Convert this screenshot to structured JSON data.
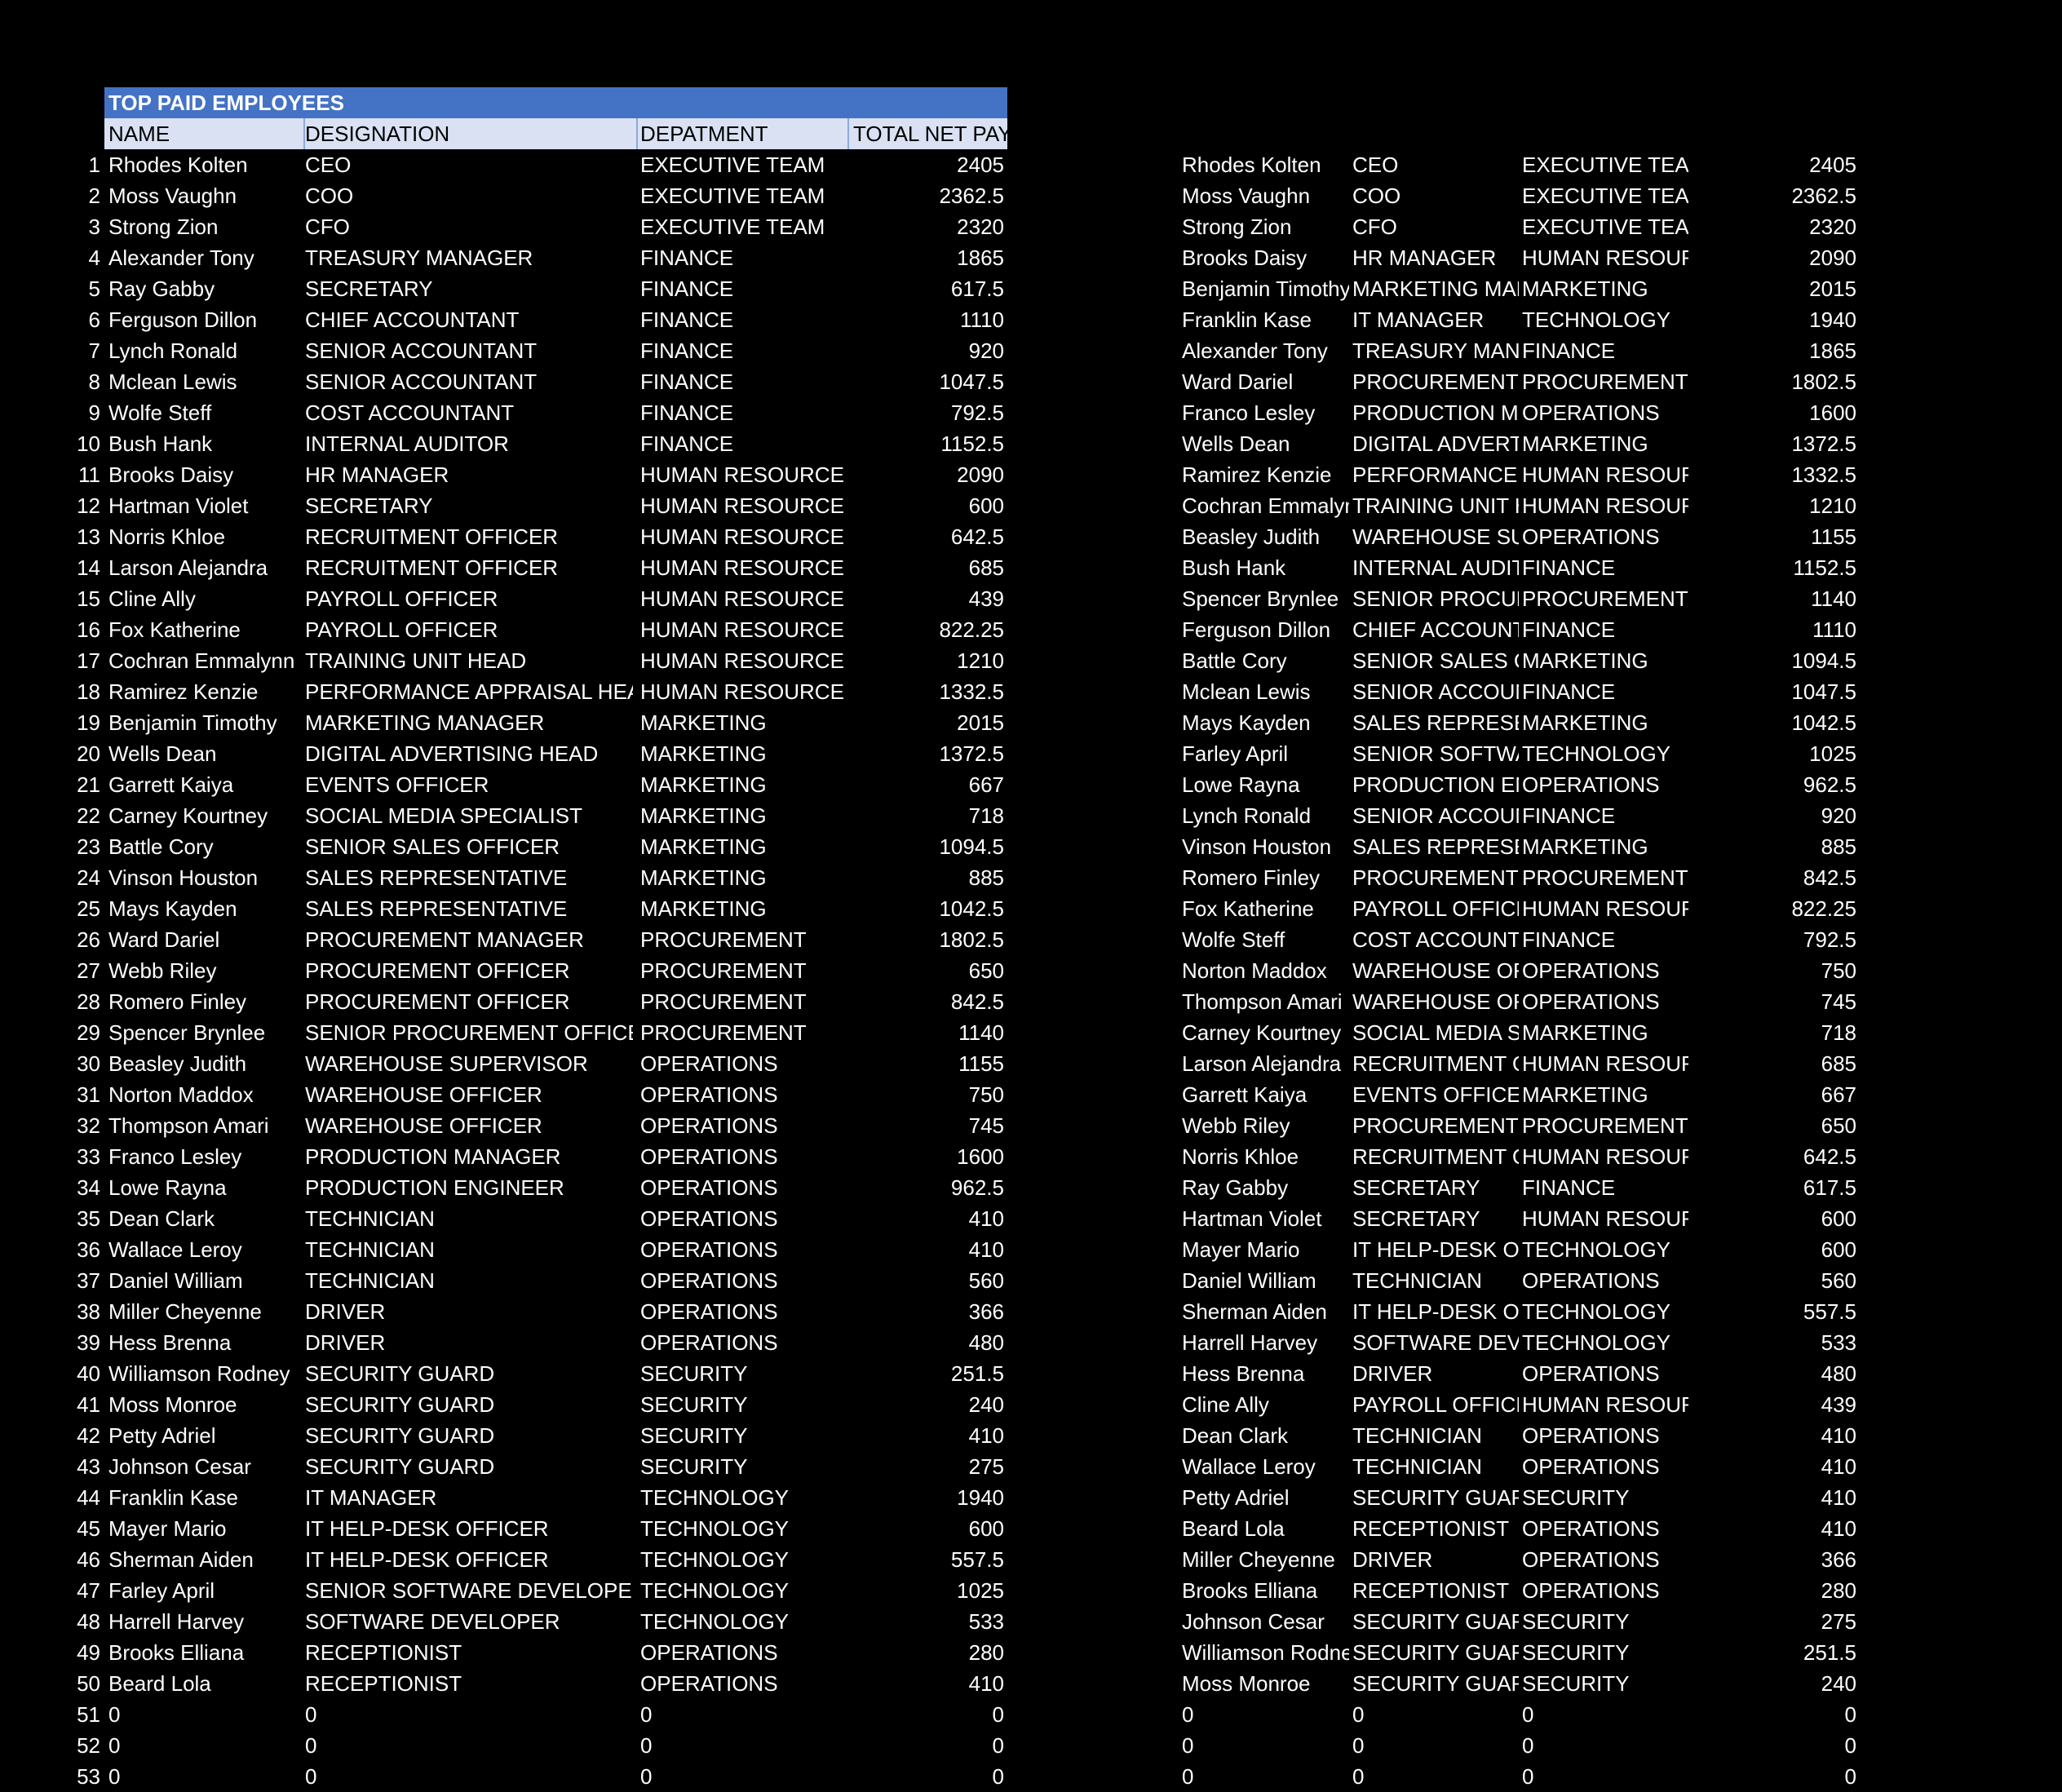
{
  "table": {
    "title": "TOP PAID EMPLOYEES",
    "headers": [
      "NAME",
      "DESIGNATION",
      "DEPATMENT",
      "TOTAL NET PAY"
    ],
    "rows": [
      {
        "n": "1",
        "name": "Rhodes Kolten",
        "designation": "CEO",
        "department": "EXECUTIVE TEAM",
        "pay": "2405"
      },
      {
        "n": "2",
        "name": "Moss Vaughn",
        "designation": "COO",
        "department": "EXECUTIVE TEAM",
        "pay": "2362.5"
      },
      {
        "n": "3",
        "name": "Strong Zion",
        "designation": "CFO",
        "department": "EXECUTIVE TEAM",
        "pay": "2320"
      },
      {
        "n": "4",
        "name": "Alexander Tony",
        "designation": "TREASURY MANAGER",
        "department": "FINANCE",
        "pay": "1865"
      },
      {
        "n": "5",
        "name": "Ray Gabby",
        "designation": "SECRETARY",
        "department": "FINANCE",
        "pay": "617.5"
      },
      {
        "n": "6",
        "name": "Ferguson Dillon",
        "designation": "CHIEF ACCOUNTANT",
        "department": "FINANCE",
        "pay": "1110"
      },
      {
        "n": "7",
        "name": "Lynch Ronald",
        "designation": "SENIOR ACCOUNTANT",
        "department": "FINANCE",
        "pay": "920"
      },
      {
        "n": "8",
        "name": "Mclean Lewis",
        "designation": "SENIOR ACCOUNTANT",
        "department": "FINANCE",
        "pay": "1047.5"
      },
      {
        "n": "9",
        "name": "Wolfe Steff",
        "designation": "COST ACCOUNTANT",
        "department": "FINANCE",
        "pay": "792.5"
      },
      {
        "n": "10",
        "name": "Bush Hank",
        "designation": "INTERNAL AUDITOR",
        "department": "FINANCE",
        "pay": "1152.5"
      },
      {
        "n": "11",
        "name": "Brooks Daisy",
        "designation": "HR MANAGER",
        "department": "HUMAN RESOURCES",
        "pay": "2090"
      },
      {
        "n": "12",
        "name": "Hartman Violet",
        "designation": "SECRETARY",
        "department": "HUMAN RESOURCES",
        "pay": "600"
      },
      {
        "n": "13",
        "name": "Norris Khloe",
        "designation": "RECRUITMENT OFFICER",
        "department": "HUMAN RESOURCES",
        "pay": "642.5"
      },
      {
        "n": "14",
        "name": "Larson Alejandra",
        "designation": "RECRUITMENT OFFICER",
        "department": "HUMAN RESOURCES",
        "pay": "685"
      },
      {
        "n": "15",
        "name": "Cline Ally",
        "designation": "PAYROLL OFFICER",
        "department": "HUMAN RESOURCES",
        "pay": "439"
      },
      {
        "n": "16",
        "name": "Fox Katherine",
        "designation": "PAYROLL OFFICER",
        "department": "HUMAN RESOURCES",
        "pay": "822.25"
      },
      {
        "n": "17",
        "name": "Cochran Emmalynn",
        "designation": "TRAINING UNIT HEAD",
        "department": "HUMAN RESOURCES",
        "pay": "1210"
      },
      {
        "n": "18",
        "name": "Ramirez Kenzie",
        "designation": "PERFORMANCE APPRAISAL HEAD",
        "department": "HUMAN RESOURCES",
        "pay": "1332.5"
      },
      {
        "n": "19",
        "name": "Benjamin Timothy",
        "designation": "MARKETING MANAGER",
        "department": "MARKETING",
        "pay": "2015"
      },
      {
        "n": "20",
        "name": "Wells Dean",
        "designation": "DIGITAL ADVERTISING HEAD",
        "department": "MARKETING",
        "pay": "1372.5"
      },
      {
        "n": "21",
        "name": "Garrett Kaiya",
        "designation": "EVENTS OFFICER",
        "department": "MARKETING",
        "pay": "667"
      },
      {
        "n": "22",
        "name": "Carney Kourtney",
        "designation": "SOCIAL MEDIA SPECIALIST",
        "department": "MARKETING",
        "pay": "718"
      },
      {
        "n": "23",
        "name": "Battle Cory",
        "designation": "SENIOR SALES OFFICER",
        "department": "MARKETING",
        "pay": "1094.5"
      },
      {
        "n": "24",
        "name": "Vinson Houston",
        "designation": "SALES REPRESENTATIVE",
        "department": "MARKETING",
        "pay": "885"
      },
      {
        "n": "25",
        "name": "Mays Kayden",
        "designation": "SALES REPRESENTATIVE",
        "department": "MARKETING",
        "pay": "1042.5"
      },
      {
        "n": "26",
        "name": "Ward Dariel",
        "designation": "PROCUREMENT MANAGER",
        "department": "PROCUREMENT",
        "pay": "1802.5"
      },
      {
        "n": "27",
        "name": "Webb Riley",
        "designation": "PROCUREMENT OFFICER",
        "department": "PROCUREMENT",
        "pay": "650"
      },
      {
        "n": "28",
        "name": "Romero Finley",
        "designation": "PROCUREMENT OFFICER",
        "department": "PROCUREMENT",
        "pay": "842.5"
      },
      {
        "n": "29",
        "name": "Spencer Brynlee",
        "designation": "SENIOR PROCUREMENT OFFICER",
        "department": "PROCUREMENT",
        "pay": "1140"
      },
      {
        "n": "30",
        "name": "Beasley Judith",
        "designation": "WAREHOUSE SUPERVISOR",
        "department": "OPERATIONS",
        "pay": "1155"
      },
      {
        "n": "31",
        "name": "Norton Maddox",
        "designation": "WAREHOUSE OFFICER",
        "department": "OPERATIONS",
        "pay": "750"
      },
      {
        "n": "32",
        "name": "Thompson Amari",
        "designation": "WAREHOUSE OFFICER",
        "department": "OPERATIONS",
        "pay": "745"
      },
      {
        "n": "33",
        "name": "Franco Lesley",
        "designation": "PRODUCTION MANAGER",
        "department": "OPERATIONS",
        "pay": "1600"
      },
      {
        "n": "34",
        "name": "Lowe Rayna",
        "designation": "PRODUCTION ENGINEER",
        "department": "OPERATIONS",
        "pay": "962.5"
      },
      {
        "n": "35",
        "name": "Dean Clark",
        "designation": "TECHNICIAN",
        "department": "OPERATIONS",
        "pay": "410"
      },
      {
        "n": "36",
        "name": "Wallace Leroy",
        "designation": "TECHNICIAN",
        "department": "OPERATIONS",
        "pay": "410"
      },
      {
        "n": "37",
        "name": "Daniel William",
        "designation": "TECHNICIAN",
        "department": "OPERATIONS",
        "pay": "560"
      },
      {
        "n": "38",
        "name": "Miller Cheyenne",
        "designation": "DRIVER",
        "department": "OPERATIONS",
        "pay": "366"
      },
      {
        "n": "39",
        "name": "Hess Brenna",
        "designation": "DRIVER",
        "department": "OPERATIONS",
        "pay": "480"
      },
      {
        "n": "40",
        "name": "Williamson Rodney",
        "designation": "SECURITY GUARD",
        "department": "SECURITY",
        "pay": "251.5"
      },
      {
        "n": "41",
        "name": "Moss Monroe",
        "designation": "SECURITY GUARD",
        "department": "SECURITY",
        "pay": "240"
      },
      {
        "n": "42",
        "name": "Petty Adriel",
        "designation": "SECURITY GUARD",
        "department": "SECURITY",
        "pay": "410"
      },
      {
        "n": "43",
        "name": "Johnson Cesar",
        "designation": "SECURITY GUARD",
        "department": "SECURITY",
        "pay": "275"
      },
      {
        "n": "44",
        "name": "Franklin Kase",
        "designation": "IT MANAGER",
        "department": "TECHNOLOGY",
        "pay": "1940"
      },
      {
        "n": "45",
        "name": "Mayer Mario",
        "designation": "IT HELP-DESK OFFICER",
        "department": "TECHNOLOGY",
        "pay": "600"
      },
      {
        "n": "46",
        "name": "Sherman Aiden",
        "designation": "IT HELP-DESK OFFICER",
        "department": "TECHNOLOGY",
        "pay": "557.5"
      },
      {
        "n": "47",
        "name": "Farley April",
        "designation": "SENIOR SOFTWARE DEVELOPER",
        "department": "TECHNOLOGY",
        "pay": "1025"
      },
      {
        "n": "48",
        "name": "Harrell Harvey",
        "designation": "SOFTWARE DEVELOPER",
        "department": "TECHNOLOGY",
        "pay": "533"
      },
      {
        "n": "49",
        "name": "Brooks Elliana",
        "designation": "RECEPTIONIST",
        "department": "OPERATIONS",
        "pay": "280"
      },
      {
        "n": "50",
        "name": "Beard Lola",
        "designation": "RECEPTIONIST",
        "department": "OPERATIONS",
        "pay": "410"
      },
      {
        "n": "51",
        "name": "0",
        "designation": "0",
        "department": "0",
        "pay": "0"
      },
      {
        "n": "52",
        "name": "0",
        "designation": "0",
        "department": "0",
        "pay": "0"
      },
      {
        "n": "53",
        "name": "0",
        "designation": "0",
        "department": "0",
        "pay": "0"
      }
    ]
  },
  "sorted": {
    "rows": [
      {
        "name": "Rhodes Kolten",
        "designation": "CEO",
        "department": "EXECUTIVE TEAM",
        "pay": "2405"
      },
      {
        "name": "Moss Vaughn",
        "designation": "COO",
        "department": "EXECUTIVE TEAM",
        "pay": "2362.5"
      },
      {
        "name": "Strong Zion",
        "designation": "CFO",
        "department": "EXECUTIVE TEAM",
        "pay": "2320"
      },
      {
        "name": "Brooks Daisy",
        "designation": "HR MANAGER",
        "department": "HUMAN RESOURCES",
        "pay": "2090"
      },
      {
        "name": "Benjamin Timothy",
        "designation": "MARKETING MANAGER",
        "department": "MARKETING",
        "pay": "2015"
      },
      {
        "name": "Franklin Kase",
        "designation": "IT MANAGER",
        "department": "TECHNOLOGY",
        "pay": "1940"
      },
      {
        "name": "Alexander Tony",
        "designation": "TREASURY MANAGER",
        "department": "FINANCE",
        "pay": "1865"
      },
      {
        "name": "Ward Dariel",
        "designation": "PROCUREMENT MANAGER",
        "department": "PROCUREMENT",
        "pay": "1802.5"
      },
      {
        "name": "Franco Lesley",
        "designation": "PRODUCTION MANAGER",
        "department": "OPERATIONS",
        "pay": "1600"
      },
      {
        "name": "Wells Dean",
        "designation": "DIGITAL ADVERTISING HEAD",
        "department": "MARKETING",
        "pay": "1372.5"
      },
      {
        "name": "Ramirez Kenzie",
        "designation": "PERFORMANCE APPRAISAL HEAD",
        "department": "HUMAN RESOURCES",
        "pay": "1332.5"
      },
      {
        "name": "Cochran Emmalynn",
        "designation": "TRAINING UNIT HEAD",
        "department": "HUMAN RESOURCES",
        "pay": "1210"
      },
      {
        "name": "Beasley Judith",
        "designation": "WAREHOUSE SUPERVISOR",
        "department": "OPERATIONS",
        "pay": "1155"
      },
      {
        "name": "Bush Hank",
        "designation": "INTERNAL AUDITOR",
        "department": "FINANCE",
        "pay": "1152.5"
      },
      {
        "name": "Spencer Brynlee",
        "designation": "SENIOR PROCUREMENT OFFICER",
        "department": "PROCUREMENT",
        "pay": "1140"
      },
      {
        "name": "Ferguson Dillon",
        "designation": "CHIEF ACCOUNTANT",
        "department": "FINANCE",
        "pay": "1110"
      },
      {
        "name": "Battle Cory",
        "designation": "SENIOR SALES OFFICER",
        "department": "MARKETING",
        "pay": "1094.5"
      },
      {
        "name": "Mclean Lewis",
        "designation": "SENIOR ACCOUNTANT",
        "department": "FINANCE",
        "pay": "1047.5"
      },
      {
        "name": "Mays Kayden",
        "designation": "SALES REPRESENTATIVE",
        "department": "MARKETING",
        "pay": "1042.5"
      },
      {
        "name": "Farley April",
        "designation": "SENIOR SOFTWARE DEVELOPER",
        "department": "TECHNOLOGY",
        "pay": "1025"
      },
      {
        "name": "Lowe Rayna",
        "designation": "PRODUCTION ENGINEER",
        "department": "OPERATIONS",
        "pay": "962.5"
      },
      {
        "name": "Lynch Ronald",
        "designation": "SENIOR ACCOUNTANT",
        "department": "FINANCE",
        "pay": "920"
      },
      {
        "name": "Vinson Houston",
        "designation": "SALES REPRESENTATIVE",
        "department": "MARKETING",
        "pay": "885"
      },
      {
        "name": "Romero Finley",
        "designation": "PROCUREMENT OFFICER",
        "department": "PROCUREMENT",
        "pay": "842.5"
      },
      {
        "name": "Fox Katherine",
        "designation": "PAYROLL OFFICER",
        "department": "HUMAN RESOURCES",
        "pay": "822.25"
      },
      {
        "name": "Wolfe Steff",
        "designation": "COST ACCOUNTANT",
        "department": "FINANCE",
        "pay": "792.5"
      },
      {
        "name": "Norton Maddox",
        "designation": "WAREHOUSE OFFICER",
        "department": "OPERATIONS",
        "pay": "750"
      },
      {
        "name": "Thompson Amari",
        "designation": "WAREHOUSE OFFICER",
        "department": "OPERATIONS",
        "pay": "745"
      },
      {
        "name": "Carney Kourtney",
        "designation": "SOCIAL MEDIA SPECIALIST",
        "department": "MARKETING",
        "pay": "718"
      },
      {
        "name": "Larson Alejandra",
        "designation": "RECRUITMENT OFFICER",
        "department": "HUMAN RESOURCES",
        "pay": "685"
      },
      {
        "name": "Garrett Kaiya",
        "designation": "EVENTS OFFICER",
        "department": "MARKETING",
        "pay": "667"
      },
      {
        "name": "Webb Riley",
        "designation": "PROCUREMENT OFFICER",
        "department": "PROCUREMENT",
        "pay": "650"
      },
      {
        "name": "Norris Khloe",
        "designation": "RECRUITMENT OFFICER",
        "department": "HUMAN RESOURCES",
        "pay": "642.5"
      },
      {
        "name": "Ray Gabby",
        "designation": "SECRETARY",
        "department": "FINANCE",
        "pay": "617.5"
      },
      {
        "name": "Hartman Violet",
        "designation": "SECRETARY",
        "department": "HUMAN RESOURCES",
        "pay": "600"
      },
      {
        "name": "Mayer Mario",
        "designation": "IT HELP-DESK OFFICER",
        "department": "TECHNOLOGY",
        "pay": "600"
      },
      {
        "name": "Daniel William",
        "designation": "TECHNICIAN",
        "department": "OPERATIONS",
        "pay": "560"
      },
      {
        "name": "Sherman Aiden",
        "designation": "IT HELP-DESK OFFICER",
        "department": "TECHNOLOGY",
        "pay": "557.5"
      },
      {
        "name": "Harrell Harvey",
        "designation": "SOFTWARE DEVELOPER",
        "department": "TECHNOLOGY",
        "pay": "533"
      },
      {
        "name": "Hess Brenna",
        "designation": "DRIVER",
        "department": "OPERATIONS",
        "pay": "480"
      },
      {
        "name": "Cline Ally",
        "designation": "PAYROLL OFFICER",
        "department": "HUMAN RESOURCES",
        "pay": "439"
      },
      {
        "name": "Dean Clark",
        "designation": "TECHNICIAN",
        "department": "OPERATIONS",
        "pay": "410"
      },
      {
        "name": "Wallace Leroy",
        "designation": "TECHNICIAN",
        "department": "OPERATIONS",
        "pay": "410"
      },
      {
        "name": "Petty Adriel",
        "designation": "SECURITY GUARD",
        "department": "SECURITY",
        "pay": "410"
      },
      {
        "name": "Beard Lola",
        "designation": "RECEPTIONIST",
        "department": "OPERATIONS",
        "pay": "410"
      },
      {
        "name": "Miller Cheyenne",
        "designation": "DRIVER",
        "department": "OPERATIONS",
        "pay": "366"
      },
      {
        "name": "Brooks Elliana",
        "designation": "RECEPTIONIST",
        "department": "OPERATIONS",
        "pay": "280"
      },
      {
        "name": "Johnson Cesar",
        "designation": "SECURITY GUARD",
        "department": "SECURITY",
        "pay": "275"
      },
      {
        "name": "Williamson Rodney",
        "designation": "SECURITY GUARD",
        "department": "SECURITY",
        "pay": "251.5"
      },
      {
        "name": "Moss Monroe",
        "designation": "SECURITY GUARD",
        "department": "SECURITY",
        "pay": "240"
      },
      {
        "name": "0",
        "designation": "0",
        "department": "0",
        "pay": "0"
      },
      {
        "name": "0",
        "designation": "0",
        "department": "0",
        "pay": "0"
      },
      {
        "name": "0",
        "designation": "0",
        "department": "0",
        "pay": "0"
      }
    ]
  },
  "colors": {
    "background": "#000000",
    "title_fill": "#4472c4",
    "header_fill": "#d9e1f2",
    "text": "#ffffff",
    "header_text": "#000000"
  }
}
